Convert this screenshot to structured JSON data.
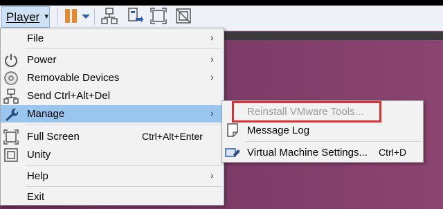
{
  "toolbar": {
    "player_label": "Player",
    "icons": [
      "pause-icon",
      "dropdown-caret-icon",
      "network-icon",
      "send-keys-icon",
      "fullscreen-icon",
      "unity-icon"
    ]
  },
  "menu": {
    "items": [
      {
        "label": "File",
        "has_submenu": true
      },
      {
        "label": "Power",
        "has_submenu": true,
        "icon": "power-icon"
      },
      {
        "label": "Removable Devices",
        "has_submenu": true,
        "icon": "disc-icon"
      },
      {
        "label": "Send Ctrl+Alt+Del",
        "icon": "send-ctrl-alt-del-icon"
      },
      {
        "label": "Manage",
        "has_submenu": true,
        "icon": "wrench-icon",
        "active": true
      },
      {
        "label": "Full Screen",
        "accelerator": "Ctrl+Alt+Enter",
        "icon": "fullscreen-icon"
      },
      {
        "label": "Unity",
        "icon": "unity-icon"
      },
      {
        "label": "Help",
        "has_submenu": true
      },
      {
        "label": "Exit"
      }
    ],
    "arrow_glyph": "›"
  },
  "submenu": {
    "items": [
      {
        "label": "Reinstall VMware Tools...",
        "disabled": true,
        "highlighted": true
      },
      {
        "label": "Message Log",
        "icon": "message-log-icon"
      },
      {
        "label": "Virtual Machine Settings...",
        "accelerator": "Ctrl+D",
        "icon": "vm-settings-icon"
      }
    ]
  },
  "colors": {
    "active_item": "#99c5ef",
    "highlight_border": "#d93232",
    "disabled_text": "#9a9a9a",
    "pause_orange": "#e38b2a",
    "background_purple": "#7a3a66"
  }
}
